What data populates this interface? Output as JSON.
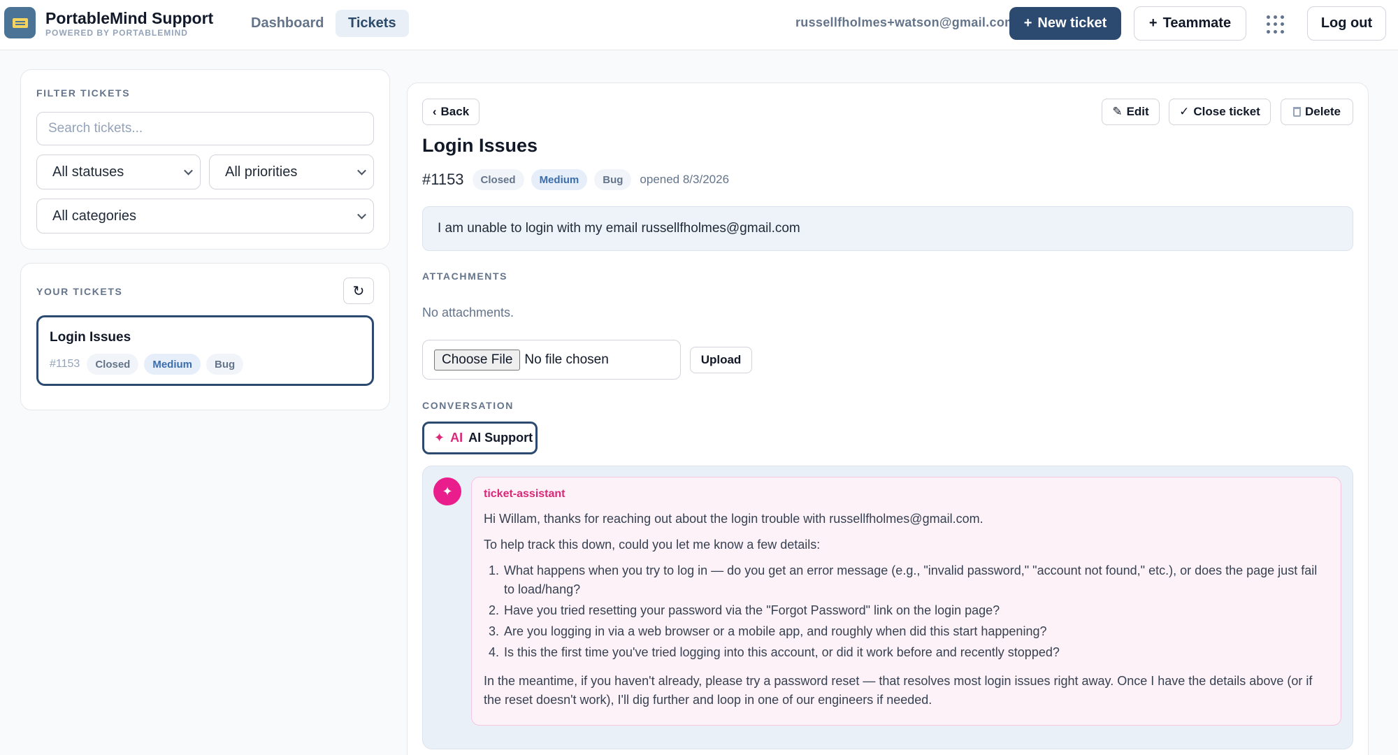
{
  "app": {
    "title": "PortableMind Support",
    "subtitle": "POWERED BY PORTABLEMIND"
  },
  "nav": {
    "tabs": [
      {
        "label": "Dashboard",
        "active": false
      },
      {
        "label": "Tickets",
        "active": true
      }
    ]
  },
  "header": {
    "user_email": "russellfholmes+watson@gmail.com",
    "new_ticket_label": "New ticket",
    "teammate_label": "Teammate",
    "logout_label": "Log out",
    "apps_icon": "grid-icon"
  },
  "filters": {
    "heading": "FILTER TICKETS",
    "search_placeholder": "Search tickets...",
    "status_selected": "All statuses",
    "priority_selected": "All priorities",
    "category_selected": "All categories"
  },
  "your_tickets": {
    "heading": "YOUR TICKETS",
    "refresh_icon": "refresh-icon",
    "items": [
      {
        "title": "Login Issues",
        "number": "#1153",
        "status": "Closed",
        "priority": "Medium",
        "category": "Bug"
      }
    ]
  },
  "detail": {
    "back_label": "Back",
    "edit_label": "Edit",
    "close_label": "Close ticket",
    "delete_label": "Delete",
    "title": "Login Issues",
    "number": "#1153",
    "status": "Closed",
    "priority": "Medium",
    "category": "Bug",
    "opened": "opened 8/3/2026",
    "description": "I am unable to login with my email russellfholmes@gmail.com",
    "attachments_heading": "ATTACHMENTS",
    "no_attachments": "No attachments.",
    "choose_file_label": "Choose File",
    "no_file_label": "No file chosen",
    "upload_label": "Upload",
    "conversation_heading": "CONVERSATION",
    "ai_tab_mark": "AI",
    "ai_tab_label": "AI Support"
  },
  "conversation": {
    "author": "ticket-assistant",
    "avatar_icon": "sparkle-icon",
    "greeting": "Hi Willam, thanks for reaching out about the login trouble with russellfholmes@gmail.com.",
    "intro": "To help track this down, could you let me know a few details:",
    "questions": [
      "What happens when you try to log in — do you get an error message (e.g., \"invalid password,\" \"account not found,\" etc.), or does the page just fail to load/hang?",
      "Have you tried resetting your password via the \"Forgot Password\" link on the login page?",
      "Are you logging in via a web browser or a mobile app, and roughly when did this start happening?",
      "Is this the first time you've tried logging into this account, or did it work before and recently stopped?"
    ],
    "closing": "In the meantime, if you haven't already, please try a password reset — that resolves most login issues right away. Once I have the details above (or if the reset doesn't work), I'll dig further and loop in one of our engineers if needed."
  },
  "colors": {
    "primary": "#2c4a6f",
    "accent_pink": "#db2777",
    "badge_blue": "#3b6dac"
  }
}
